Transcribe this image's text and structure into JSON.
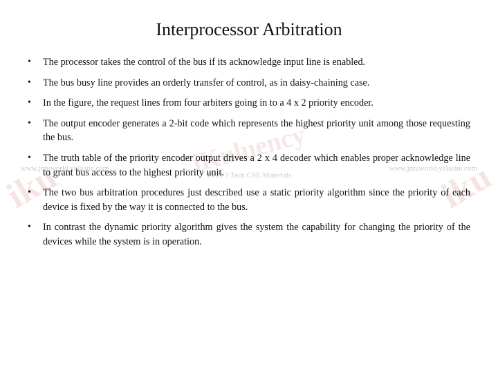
{
  "title": "Interprocessor Arbitration",
  "watermarks": {
    "left": "iku",
    "right": "iku",
    "center": "iKuluency",
    "label": "JNTJ 3 Tech CSE Materials",
    "url_left": "www.jntuworld.yolasite.com",
    "url_right": "www.jntuworld.yolasite.com"
  },
  "bullets": [
    {
      "id": 1,
      "text": "The processor takes the control of the bus if its acknowledge input line is enabled."
    },
    {
      "id": 2,
      "text": "The bus busy line provides an orderly transfer of control, as in daisy-chaining case."
    },
    {
      "id": 3,
      "text": "In the figure, the request lines from four arbiters going in to a 4 x 2 priority encoder."
    },
    {
      "id": 4,
      "text": "The output encoder generates a 2-bit code which represents the highest priority unit among those requesting the bus."
    },
    {
      "id": 5,
      "text": "The truth table of the priority encoder output drives a 2 x 4 decoder which enables proper acknowledge line to grant bus access to the highest priority unit."
    },
    {
      "id": 6,
      "text": "The two bus arbitration procedures just described use a static priority algorithm since the priority of each device is fixed by the way it is connected to the bus."
    },
    {
      "id": 7,
      "text": "In contrast the dynamic priority algorithm gives the system the capability for changing the priority of the devices while the system is in operation."
    }
  ]
}
